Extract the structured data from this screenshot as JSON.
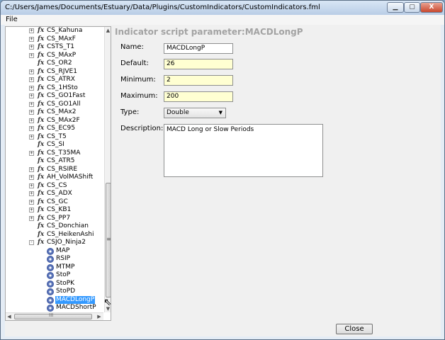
{
  "window": {
    "title": "C:/Users/James/Documents/Estuary/Data/Plugins/CustomIndicators/CustomIndicators.fml",
    "min_glyph": "▁",
    "max_glyph": "▢",
    "close_glyph": "X"
  },
  "menu": {
    "file": "File"
  },
  "tree": {
    "expand_glyph": "+",
    "collapse_glyph": "-",
    "items": [
      {
        "label": "CS_Kahuna",
        "kind": "indicator",
        "expander": "+"
      },
      {
        "label": "CS_MAxF",
        "kind": "indicator",
        "expander": "+"
      },
      {
        "label": "CSTS_T1",
        "kind": "indicator",
        "expander": "+"
      },
      {
        "label": "CS_MAxP",
        "kind": "indicator",
        "expander": "+"
      },
      {
        "label": "CS_OR2",
        "kind": "indicator",
        "expander": ""
      },
      {
        "label": "CS_RJVE1",
        "kind": "indicator",
        "expander": "+"
      },
      {
        "label": "CS_ATRX",
        "kind": "indicator",
        "expander": "+"
      },
      {
        "label": "CS_1HSto",
        "kind": "indicator",
        "expander": "+"
      },
      {
        "label": "CS_GO1Fast",
        "kind": "indicator",
        "expander": "+"
      },
      {
        "label": "CS_GO1All",
        "kind": "indicator",
        "expander": "+"
      },
      {
        "label": "CS_MAx2",
        "kind": "indicator",
        "expander": "+"
      },
      {
        "label": "CS_MAx2F",
        "kind": "indicator",
        "expander": "+"
      },
      {
        "label": "CS_EC95",
        "kind": "indicator",
        "expander": "+"
      },
      {
        "label": "CS_T5",
        "kind": "indicator",
        "expander": "+"
      },
      {
        "label": "CS_SI",
        "kind": "indicator",
        "expander": ""
      },
      {
        "label": "CS_T35MA",
        "kind": "indicator",
        "expander": "+"
      },
      {
        "label": "CS_ATR5",
        "kind": "indicator",
        "expander": ""
      },
      {
        "label": "CS_RSIRE",
        "kind": "indicator",
        "expander": "+"
      },
      {
        "label": "AH_VolMAShift",
        "kind": "indicator",
        "expander": "+"
      },
      {
        "label": "CS_CS",
        "kind": "indicator",
        "expander": "+"
      },
      {
        "label": "CS_ADX",
        "kind": "indicator",
        "expander": "+"
      },
      {
        "label": "CS_GC",
        "kind": "indicator",
        "expander": "+"
      },
      {
        "label": "CS_KB1",
        "kind": "indicator",
        "expander": "+"
      },
      {
        "label": "CS_PP7",
        "kind": "indicator",
        "expander": "+"
      },
      {
        "label": "CS_Donchian",
        "kind": "indicator",
        "expander": ""
      },
      {
        "label": "CS_HeikenAshi",
        "kind": "indicator",
        "expander": ""
      },
      {
        "label": "CSJO_Ninja2",
        "kind": "indicator",
        "expander": "-"
      },
      {
        "label": "MAP",
        "kind": "param"
      },
      {
        "label": "RSIP",
        "kind": "param"
      },
      {
        "label": "MTMP",
        "kind": "param"
      },
      {
        "label": "StoP",
        "kind": "param"
      },
      {
        "label": "StoPK",
        "kind": "param"
      },
      {
        "label": "StoPD",
        "kind": "param"
      },
      {
        "label": "MACDLongP",
        "kind": "param",
        "selected": true
      },
      {
        "label": "MACDShortP",
        "kind": "param"
      }
    ],
    "fx_glyph": "fx",
    "scroll_up": "▲",
    "scroll_down": "▼",
    "scroll_grip": "≡",
    "scroll_left": "◀",
    "scroll_right": "▶",
    "hscroll_grip": "III"
  },
  "panel": {
    "title": "Indicator script parameter:MACDLongP",
    "name_label": "Name:",
    "name_value": "MACDLongP",
    "default_label": "Default:",
    "default_value": "26",
    "minimum_label": "Minimum:",
    "minimum_value": "2",
    "maximum_label": "Maximum:",
    "maximum_value": "200",
    "type_label": "Type:",
    "type_value": "Double",
    "type_caret": "▼",
    "description_label": "Description:",
    "description_value": "MACD Long or Slow Periods"
  },
  "buttons": {
    "close": "Close"
  },
  "colors": {
    "selection": "#3399ff",
    "numeric_field_bg": "#ffffd2",
    "panel_title": "#a3a3a3",
    "window_close": "#c9462c"
  }
}
